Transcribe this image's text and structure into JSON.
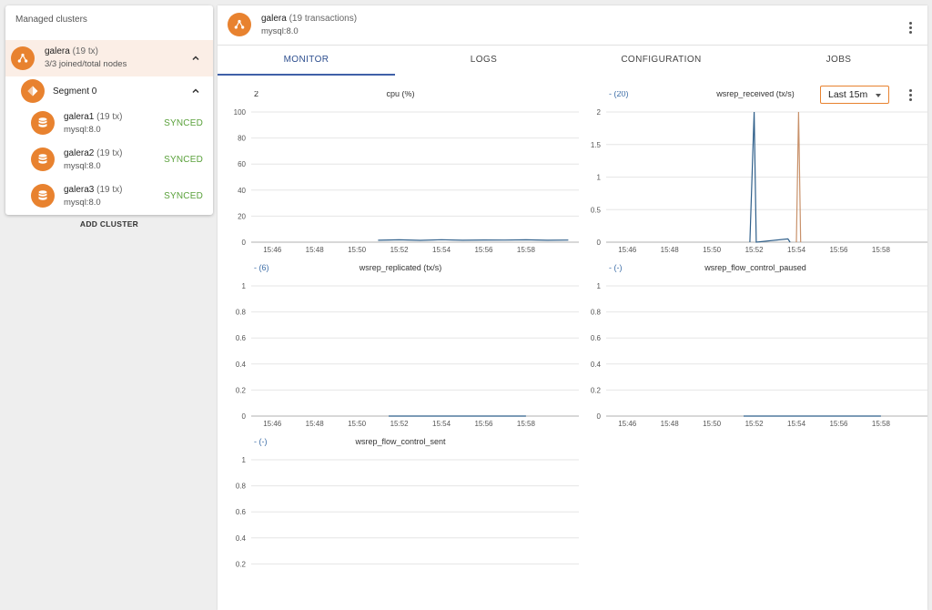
{
  "sidebar": {
    "title": "Managed clusters",
    "cluster": {
      "name": "galera",
      "tx": "(19 tx)",
      "subtitle": "3/3 joined/total nodes"
    },
    "segment": {
      "label": "Segment 0"
    },
    "nodes": [
      {
        "name": "galera1",
        "tx": "(19 tx)",
        "version": "mysql:8.0",
        "status": "SYNCED"
      },
      {
        "name": "galera2",
        "tx": "(19 tx)",
        "version": "mysql:8.0",
        "status": "SYNCED"
      },
      {
        "name": "galera3",
        "tx": "(19 tx)",
        "version": "mysql:8.0",
        "status": "SYNCED"
      }
    ],
    "add_cluster_label": "ADD CLUSTER"
  },
  "header": {
    "name": "galera",
    "tx": "(19 transactions)",
    "version": "mysql:8.0"
  },
  "tabs": [
    {
      "label": "MONITOR",
      "active": true
    },
    {
      "label": "LOGS",
      "active": false
    },
    {
      "label": "CONFIGURATION",
      "active": false
    },
    {
      "label": "JOBS",
      "active": false
    }
  ],
  "toolbar": {
    "range_label": "Last 15m"
  },
  "colors": {
    "accent": "#e8822f",
    "synced": "#5aa13b",
    "series_blue": "#2f5f8a",
    "series_brown": "#c8916a",
    "tab_active": "#3f60a8"
  },
  "chart_data": [
    {
      "type": "line",
      "title": "cpu (%)",
      "legend": "2",
      "x_ticks": [
        "15:46",
        "15:48",
        "15:50",
        "15:52",
        "15:54",
        "15:56",
        "15:58"
      ],
      "y_ticks": [
        "0",
        "20",
        "40",
        "60",
        "80",
        "100"
      ],
      "ylim": [
        0,
        100
      ],
      "series": [
        {
          "color": "#2f5f8a",
          "x": [
            "15:51",
            "15:52",
            "15:53",
            "15:54",
            "15:55",
            "15:56",
            "15:57",
            "15:58",
            "15:59",
            "16:00"
          ],
          "values": [
            1.5,
            1.8,
            1.4,
            1.9,
            1.5,
            1.7,
            1.6,
            1.8,
            1.5,
            1.6
          ]
        }
      ]
    },
    {
      "type": "line",
      "title": "wsrep_received (tx/s)",
      "legend": "- (20)",
      "x_ticks": [
        "15:46",
        "15:48",
        "15:50",
        "15:52",
        "15:54",
        "15:56",
        "15:58"
      ],
      "y_ticks": [
        "0",
        "0.5",
        "1",
        "1.5",
        "2"
      ],
      "ylim": [
        0,
        2
      ],
      "series": [
        {
          "color": "#2f5f8a",
          "x": [
            "15:51.8",
            "15:52",
            "15:52.1",
            "15:53.6",
            "15:53.7"
          ],
          "values": [
            0,
            2,
            0,
            0.05,
            0
          ]
        },
        {
          "color": "#c8916a",
          "x": [
            "15:54",
            "15:54.1",
            "15:54.2"
          ],
          "values": [
            0,
            2,
            0
          ]
        }
      ]
    },
    {
      "type": "line",
      "title": "wsrep_replicated (tx/s)",
      "legend": "- (6)",
      "x_ticks": [
        "15:46",
        "15:48",
        "15:50",
        "15:52",
        "15:54",
        "15:56",
        "15:58"
      ],
      "y_ticks": [
        "0",
        "0.2",
        "0.4",
        "0.6",
        "0.8",
        "1"
      ],
      "ylim": [
        0,
        1
      ],
      "series": [
        {
          "color": "#2f5f8a",
          "x": [
            "15:51.5",
            "15:58"
          ],
          "values": [
            0,
            0
          ]
        }
      ]
    },
    {
      "type": "line",
      "title": "wsrep_flow_control_paused",
      "legend": "- (-)",
      "x_ticks": [
        "15:46",
        "15:48",
        "15:50",
        "15:52",
        "15:54",
        "15:56",
        "15:58"
      ],
      "y_ticks": [
        "0",
        "0.2",
        "0.4",
        "0.6",
        "0.8",
        "1"
      ],
      "ylim": [
        0,
        1
      ],
      "series": [
        {
          "color": "#2f5f8a",
          "x": [
            "15:51.5",
            "15:58"
          ],
          "values": [
            0,
            0
          ]
        }
      ]
    },
    {
      "type": "line",
      "title": "wsrep_flow_control_sent",
      "legend": "- (-)",
      "x_ticks": [],
      "y_ticks": [
        "0.2",
        "0.4",
        "0.6",
        "0.8",
        "1"
      ],
      "ylim": [
        0,
        1
      ],
      "series": []
    }
  ]
}
